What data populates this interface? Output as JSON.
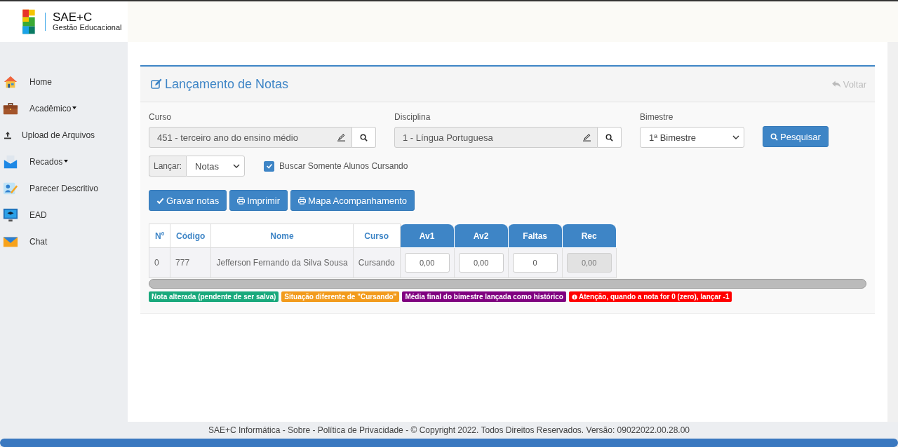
{
  "logo": {
    "title": "SAE+C",
    "subtitle": "Gestão Educacional"
  },
  "sidebar": {
    "items": [
      {
        "label": "Home",
        "dropdown": false
      },
      {
        "label": "Acadêmico",
        "dropdown": true
      },
      {
        "label": "Upload de Arquivos",
        "dropdown": false
      },
      {
        "label": "Recados",
        "dropdown": true
      },
      {
        "label": "Parecer Descritivo",
        "dropdown": false
      },
      {
        "label": "EAD",
        "dropdown": false
      },
      {
        "label": "Chat",
        "dropdown": false
      }
    ]
  },
  "panel": {
    "title": "Lançamento de Notas",
    "back": "Voltar"
  },
  "filters": {
    "curso": {
      "label": "Curso",
      "value": "451 - terceiro ano do ensino médio"
    },
    "disciplina": {
      "label": "Disciplina",
      "value": "1 - Língua Portuguesa"
    },
    "bimestre": {
      "label": "Bimestre",
      "value": "1ª Bimestre"
    },
    "search_button": "Pesquisar",
    "lancar": {
      "label": "Lançar:",
      "value": "Notas"
    },
    "only_active": {
      "label": "Buscar Somente Alunos Cursando",
      "checked": true
    }
  },
  "actions": [
    {
      "label": "Gravar notas"
    },
    {
      "label": "Imprimir"
    },
    {
      "label": "Mapa Acompanhamento"
    }
  ],
  "table": {
    "columns": [
      {
        "label": "Nº",
        "kind": "plain"
      },
      {
        "label": "Código",
        "kind": "plain"
      },
      {
        "label": "Nome",
        "kind": "plain"
      },
      {
        "label": "Curso",
        "kind": "plain"
      },
      {
        "label": "Av1",
        "kind": "grade"
      },
      {
        "label": "Av2",
        "kind": "grade"
      },
      {
        "label": "Faltas",
        "kind": "grade"
      },
      {
        "label": "Rec",
        "kind": "grade"
      }
    ],
    "rows": [
      {
        "cells": [
          {
            "kind": "text",
            "text": "0"
          },
          {
            "kind": "text",
            "text": "777"
          },
          {
            "kind": "text",
            "text": "Jefferson Fernando da Silva Sousa"
          },
          {
            "kind": "text",
            "text": "Cursando"
          },
          {
            "kind": "input",
            "value": "0,00",
            "disabled": false
          },
          {
            "kind": "input",
            "value": "0,00",
            "disabled": false
          },
          {
            "kind": "input",
            "value": "0",
            "disabled": false
          },
          {
            "kind": "input",
            "value": "0,00",
            "disabled": true
          }
        ]
      }
    ]
  },
  "legend": [
    {
      "text": "Nota alterada (pendente de ser salva)",
      "color": "#1aa97c"
    },
    {
      "text": "Situação diferente de \"Cursando\"",
      "color": "#f29b1d"
    },
    {
      "text": "Média final do bimestre lançada como histórico",
      "color": "#800080"
    },
    {
      "text": "Atenção, quando a nota for 0 (zero), lançar -1",
      "color": "#ff0000"
    }
  ],
  "footer": "SAE+C Informática - Sobre - Política de Privacidade - © Copyright 2022. Todos Direitos Reservados. Versão: 09022022.00.28.00"
}
